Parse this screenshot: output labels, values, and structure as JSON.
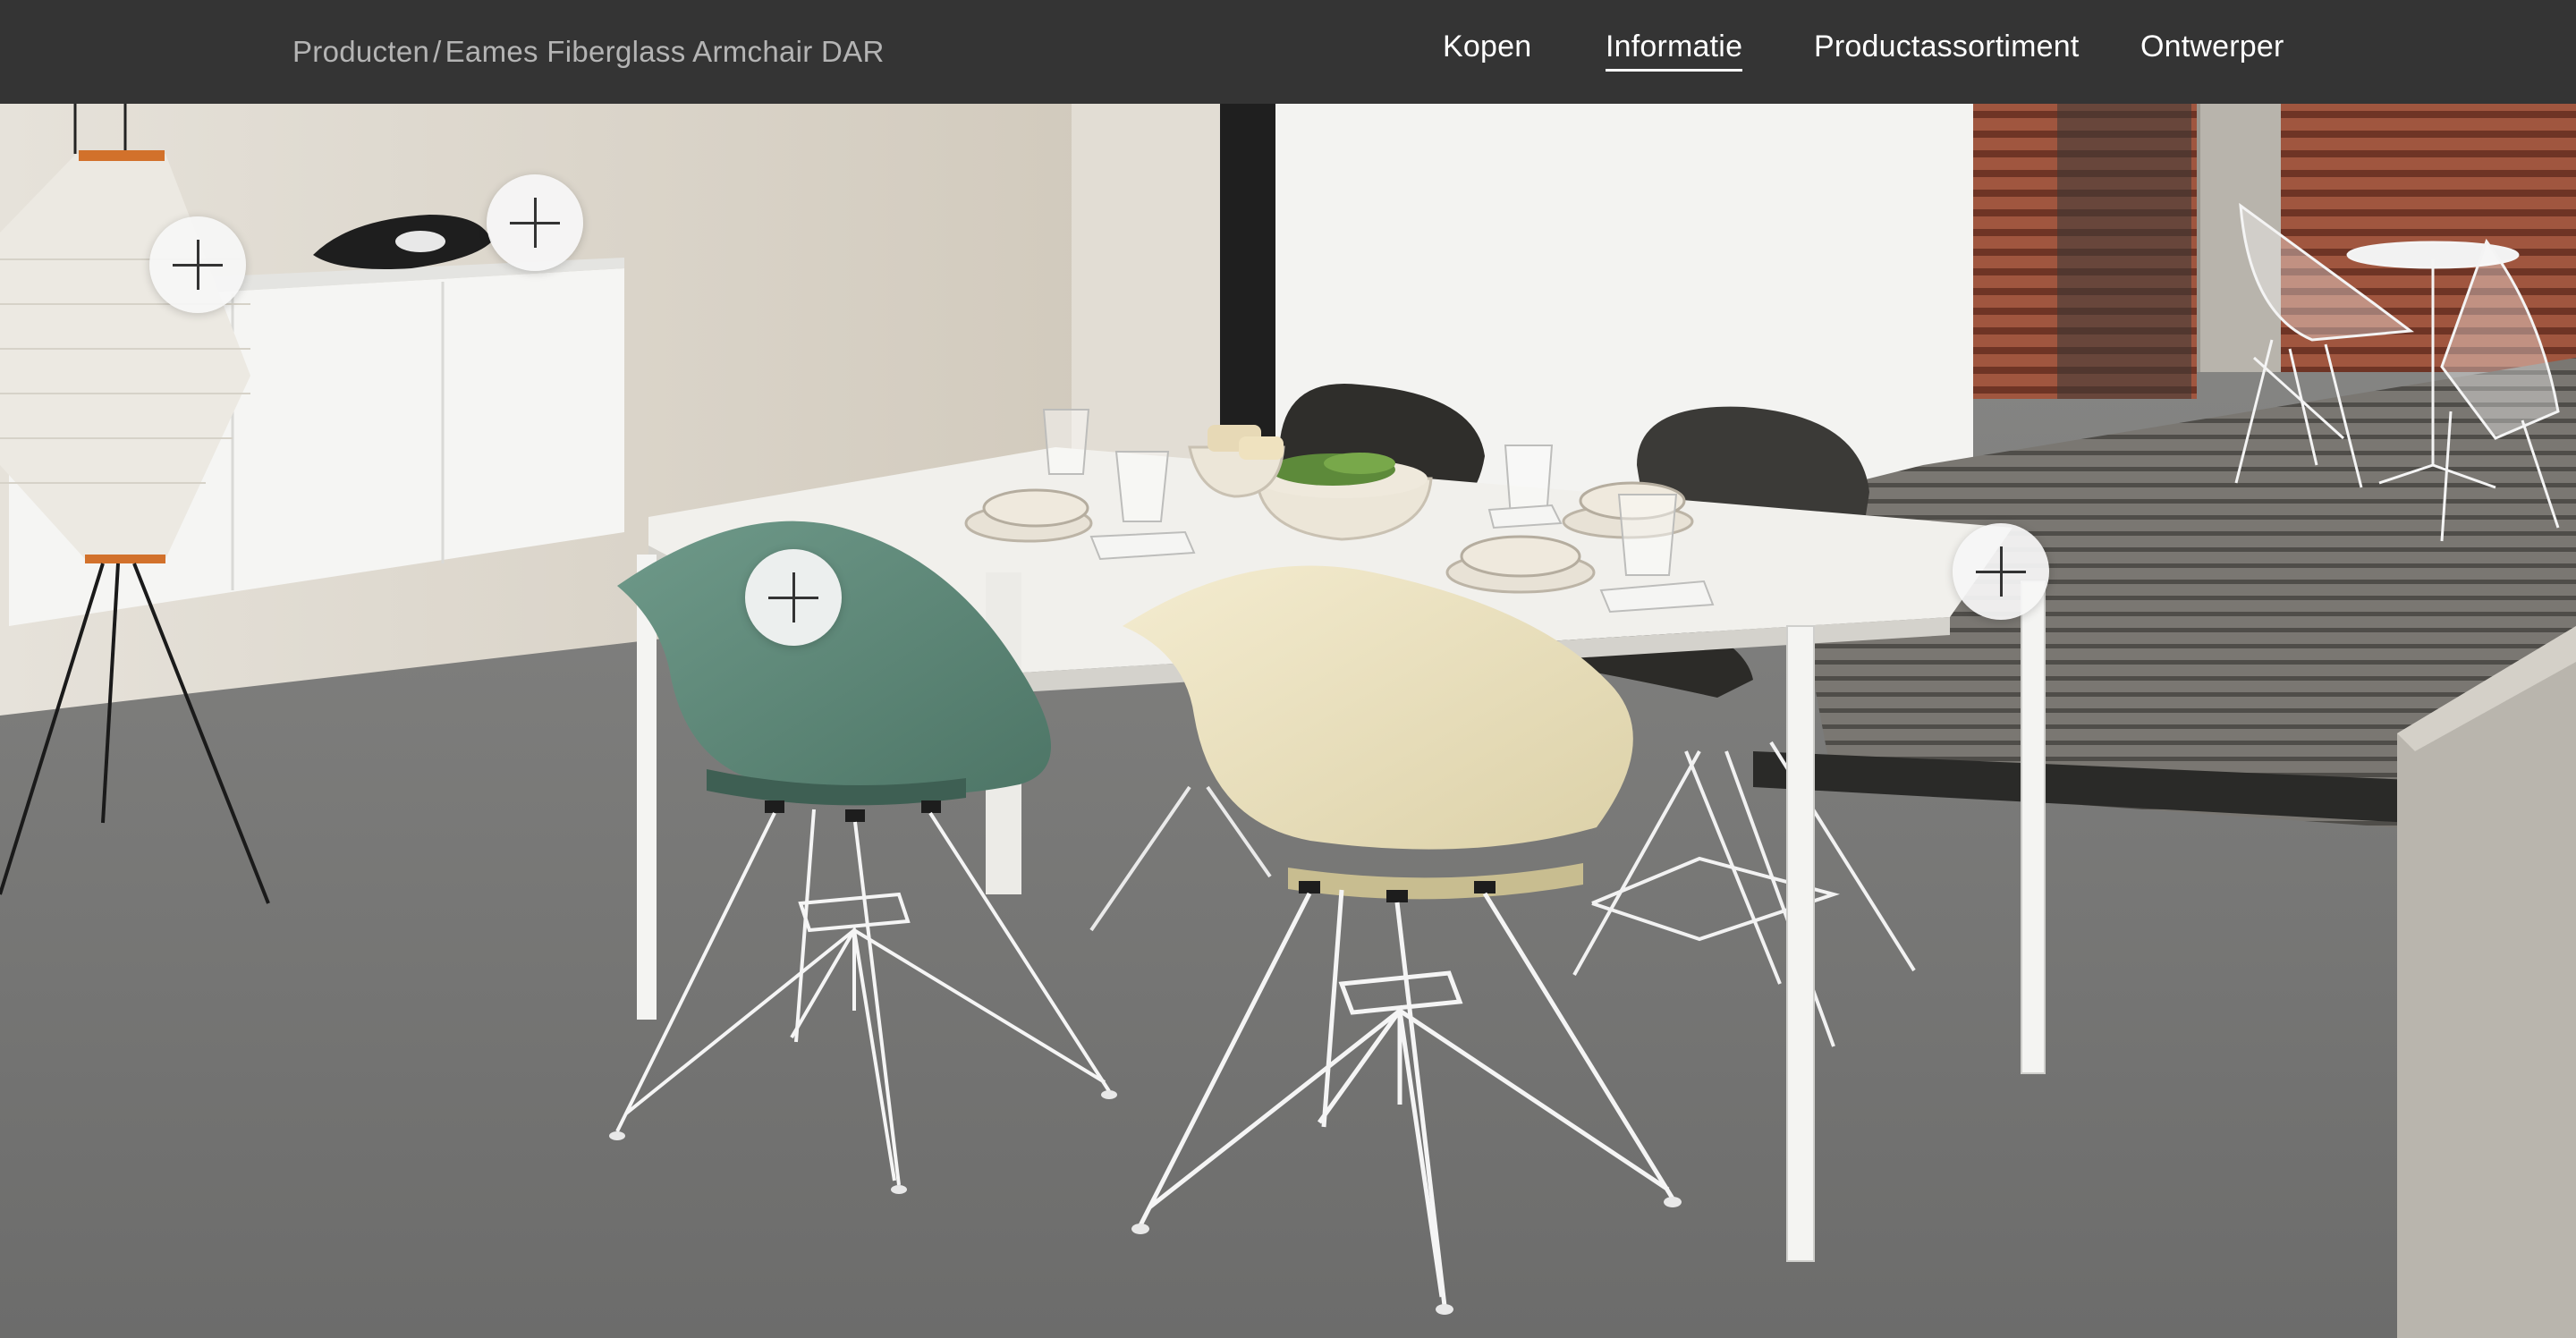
{
  "breadcrumb": {
    "parent": "Producten",
    "separator": "/",
    "current": "Eames Fiberglass Armchair DAR"
  },
  "nav": {
    "items": [
      {
        "label": "Kopen",
        "active": false
      },
      {
        "label": "Informatie",
        "active": true
      },
      {
        "label": "Productassortiment",
        "active": false
      },
      {
        "label": "Ontwerper",
        "active": false
      }
    ]
  },
  "hero": {
    "icons": [
      "plus-icon"
    ],
    "colors": {
      "topbar": "#343434",
      "chair_green": "#5f8a7b",
      "chair_cream": "#ece3c2",
      "chair_dark": "#3b3a37",
      "floor": "#7a7a7a",
      "wall": "#d9d4ca"
    }
  }
}
